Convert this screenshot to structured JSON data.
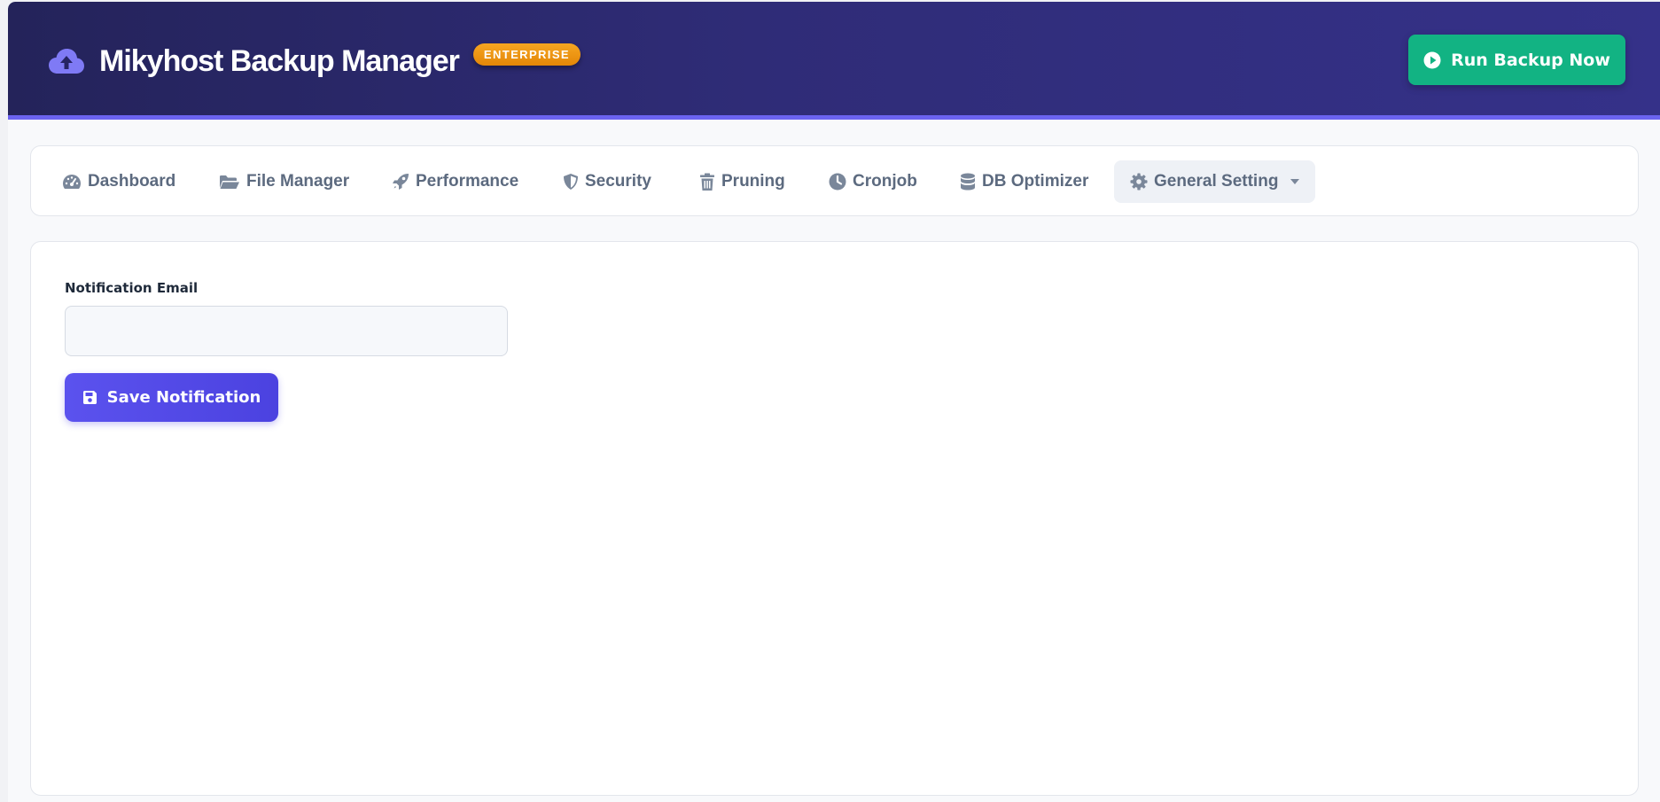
{
  "header": {
    "title": "Mikyhost Backup Manager",
    "badge": "ENTERPRISE",
    "logo_icon": "cloud-upload-icon",
    "run_button_label": "Run Backup Now",
    "run_button_icon": "play-circle-icon"
  },
  "nav": {
    "items": [
      {
        "label": "Dashboard",
        "icon": "gauge-icon"
      },
      {
        "label": "File Manager",
        "icon": "folder-open-icon"
      },
      {
        "label": "Performance",
        "icon": "rocket-icon"
      },
      {
        "label": "Security",
        "icon": "shield-icon"
      },
      {
        "label": "Pruning",
        "icon": "trash-icon"
      },
      {
        "label": "Cronjob",
        "icon": "clock-icon"
      },
      {
        "label": "DB Optimizer",
        "icon": "database-icon"
      },
      {
        "label": "General Setting",
        "icon": "gear-icon",
        "active": true,
        "dropdown": true
      }
    ]
  },
  "notification": {
    "email_label": "Notification Email",
    "email_value": "",
    "email_placeholder": "",
    "save_label": "Save Notification",
    "save_icon": "floppy-disk-icon"
  },
  "colors": {
    "header_gradient_start": "#24235a",
    "header_gradient_end": "#353189",
    "header_accent_border": "#6b63f0",
    "badge": "#f29a16",
    "run_button": "#12b383",
    "save_button": "#554ceb",
    "nav_text": "#5c6a7f"
  }
}
